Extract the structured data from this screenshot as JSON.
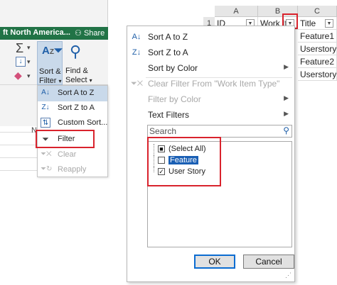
{
  "title_bar": {
    "account": "ft North America...",
    "share": "Share"
  },
  "ribbon": {
    "sort_filter_label_1": "Sort &",
    "sort_filter_label_2": "Filter",
    "find_select_label_1": "Find &",
    "find_select_label_2": "Select"
  },
  "sort_menu": {
    "items": [
      {
        "label": "Sort A to Z",
        "icon": "sort-az-icon",
        "disabled": false
      },
      {
        "label": "Sort Z to A",
        "icon": "sort-za-icon",
        "disabled": false
      },
      {
        "label": "Custom Sort...",
        "icon": "custom-sort-icon",
        "disabled": false
      },
      {
        "label": "Filter",
        "icon": "filter-icon",
        "disabled": false
      },
      {
        "label": "Clear",
        "icon": "clear-filter-icon",
        "disabled": true
      },
      {
        "label": "Reapply",
        "icon": "reapply-icon",
        "disabled": true
      }
    ]
  },
  "left_grid": {
    "col_letter": "N"
  },
  "sheet": {
    "col_letters": [
      "A",
      "B",
      "C"
    ],
    "header_row": {
      "row_num": "1",
      "cells": [
        "ID",
        "Work It",
        "Title"
      ]
    },
    "rows": [
      {
        "cell": "Feature1"
      },
      {
        "cell": "Userstory"
      },
      {
        "cell": "Feature2"
      },
      {
        "cell": "Userstory"
      }
    ]
  },
  "filter_menu": {
    "sort_a_to_z": "Sort A to Z",
    "sort_z_to_a": "Sort Z to A",
    "sort_by_color": "Sort by Color",
    "clear_filter": "Clear Filter From \"Work Item Type\"",
    "filter_by_color": "Filter by Color",
    "text_filters": "Text Filters",
    "search_placeholder": "Search",
    "options": [
      {
        "label": "(Select All)",
        "state": "partial"
      },
      {
        "label": "Feature",
        "state": "unchecked"
      },
      {
        "label": "User Story",
        "state": "checked"
      }
    ],
    "ok": "OK",
    "cancel": "Cancel"
  },
  "colors": {
    "excel_green": "#217346",
    "highlight": "#d9232d",
    "selection": "#1a5fb4"
  }
}
